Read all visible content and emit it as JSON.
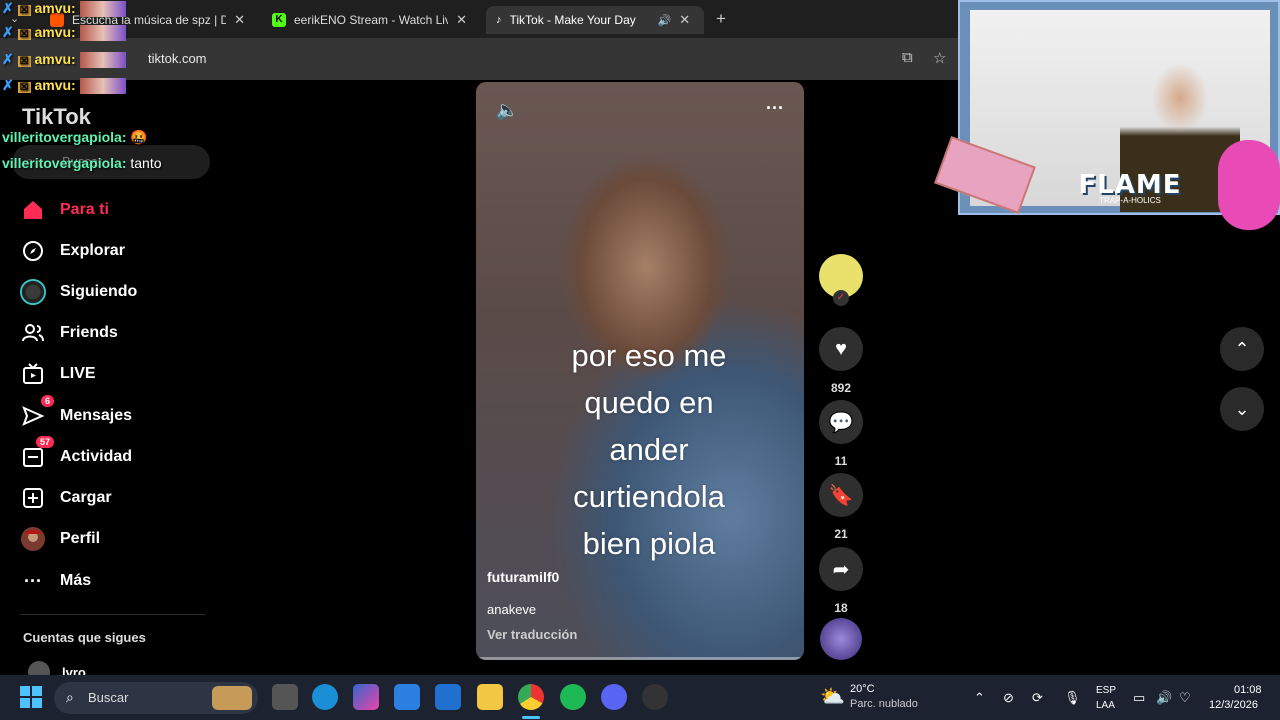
{
  "browser": {
    "tabs": [
      {
        "title": "Escucha la música de spz | Disfr",
        "favicon_color": "#ff5500"
      },
      {
        "title": "eerikENO Stream - Watch Live c",
        "favicon_color": "#53fc18"
      },
      {
        "title": "TikTok - Make Your Day",
        "favicon_color": "#ffffff"
      }
    ],
    "new_tab": "+",
    "url": "tiktok.com"
  },
  "chat_overlay": [
    {
      "user": "amvu:",
      "msg": ""
    },
    {
      "user": "amvu:",
      "msg": ""
    },
    {
      "user": "amvu:",
      "msg": ""
    },
    {
      "user": "amvu:",
      "msg": ""
    },
    {
      "user": "villeritovergapiola:",
      "msg": "🤬"
    },
    {
      "user": "villeritovergapiola:",
      "msg": "tanto"
    }
  ],
  "sidebar": {
    "logo": "TikTok",
    "search_placeholder": "Buscar",
    "items": [
      {
        "label": "Para ti",
        "icon": "home-icon",
        "active": true
      },
      {
        "label": "Explorar",
        "icon": "compass-icon"
      },
      {
        "label": "Siguiendo",
        "icon": "following-icon"
      },
      {
        "label": "Friends",
        "icon": "friends-icon"
      },
      {
        "label": "LIVE",
        "icon": "live-icon"
      },
      {
        "label": "Mensajes",
        "icon": "messages-icon",
        "badge": "6"
      },
      {
        "label": "Actividad",
        "icon": "activity-icon",
        "badge": "57"
      },
      {
        "label": "Cargar",
        "icon": "upload-icon"
      },
      {
        "label": "Perfil",
        "icon": "profile-icon"
      },
      {
        "label": "Más",
        "icon": "more-icon"
      }
    ],
    "following_header": "Cuentas que sigues",
    "following_first": "lvro"
  },
  "video": {
    "caption_lines": [
      "por eso me",
      "quedo en",
      "ander",
      "curtiendola",
      "bien piola"
    ],
    "author": "futuramilf0",
    "sound": "anakeve",
    "translate": "Ver traducción"
  },
  "actions": {
    "likes": "892",
    "comments": "11",
    "saves": "21",
    "shares": "18"
  },
  "webcam": {
    "banner": "FLAME",
    "sub": "TRAP-A-HOLICS"
  },
  "taskbar": {
    "search": "Buscar",
    "weather_temp": "20°C",
    "weather_desc": "Parc. nublado",
    "lang_top": "ESP",
    "lang_bottom": "LAA",
    "time": "01:08",
    "date": "12/3/2026"
  },
  "colors": {
    "accent": "#fe2c55",
    "bg": "#000000",
    "taskbar": "#1c2230"
  }
}
